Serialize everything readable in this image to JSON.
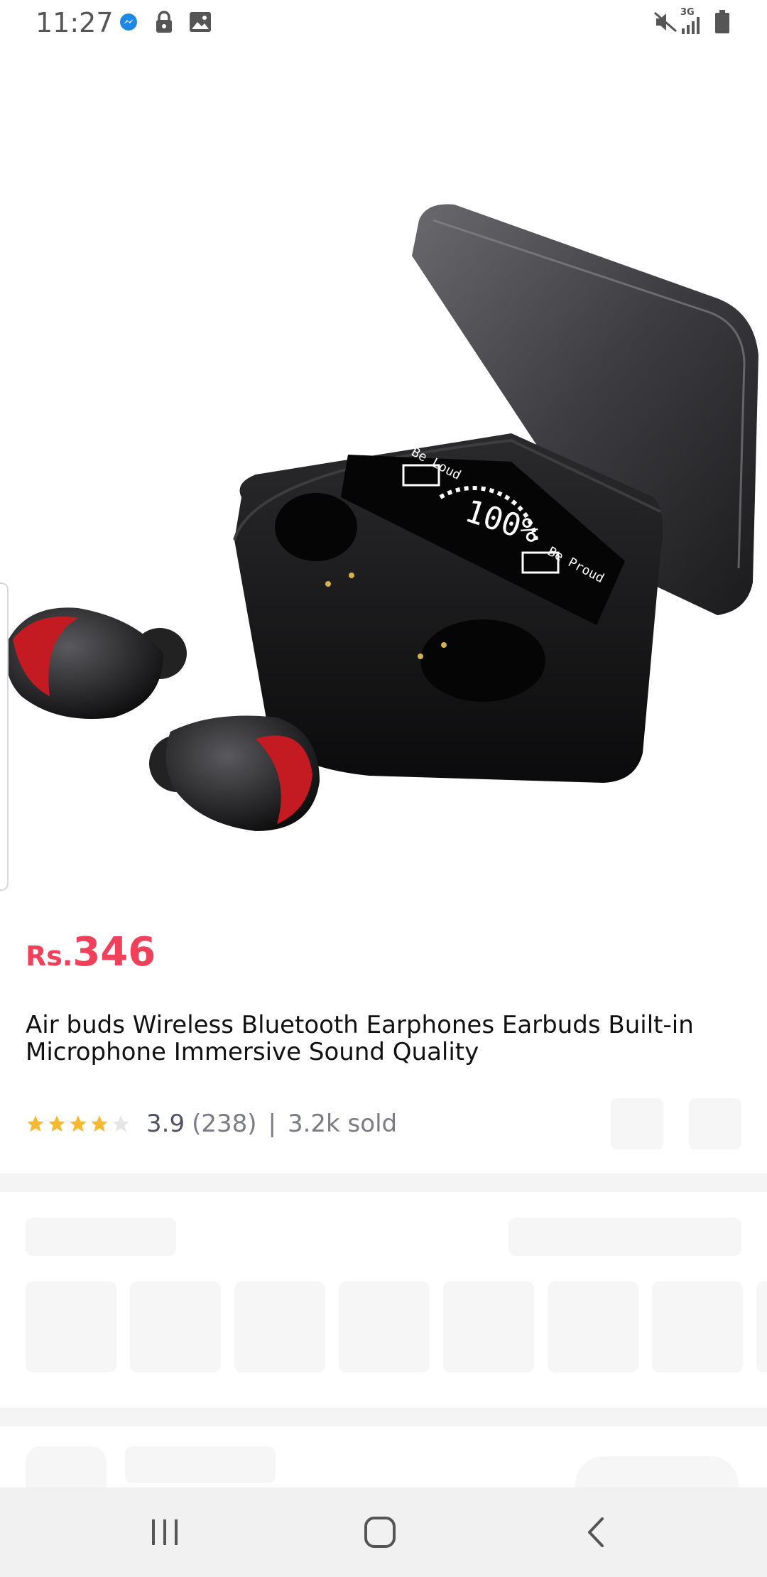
{
  "status_bar": {
    "time": "11:27",
    "network": "3G",
    "icons": [
      "messenger-icon",
      "lock-icon",
      "image-icon",
      "mute-icon",
      "signal-icon",
      "battery-icon"
    ]
  },
  "product": {
    "currency": "Rs.",
    "price": "346",
    "title": "Air buds Wireless Bluetooth Earphones Earbuds Built-in Microphone Immersive Sound Quality",
    "rating": "3.9",
    "rating_stars": 3.9,
    "review_count": "(238)",
    "separator": "|",
    "sold": "3.2k sold"
  },
  "case_display": {
    "top_label": "Be Loud",
    "bottom_label": "Be Proud",
    "percent": "100%",
    "left_marker": "L",
    "right_marker": "R"
  },
  "colors": {
    "price": "#f0405a",
    "star": "#f5b82e",
    "placeholder": "#f6f6f6"
  },
  "navigation": {
    "icons": [
      "recent-apps-icon",
      "home-icon",
      "back-icon"
    ]
  }
}
